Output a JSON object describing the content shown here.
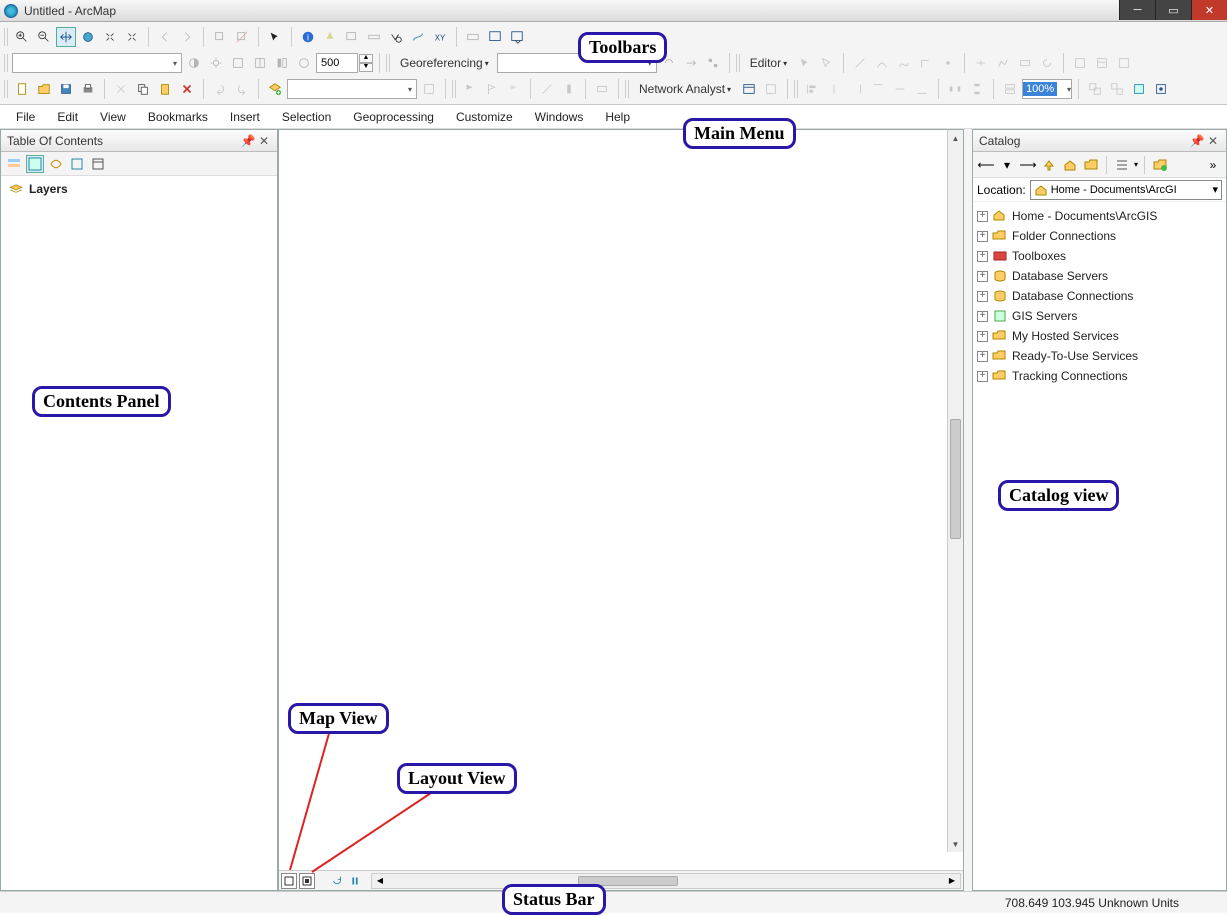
{
  "window": {
    "title": "Untitled - ArcMap"
  },
  "main_menu": [
    "File",
    "Edit",
    "View",
    "Bookmarks",
    "Insert",
    "Selection",
    "Geoprocessing",
    "Customize",
    "Windows",
    "Help"
  ],
  "georef_label": "Georeferencing",
  "editor_label": "Editor",
  "na_label": "Network Analyst",
  "scale_value": "500",
  "zoom_pct": "100%",
  "toc": {
    "title": "Table Of Contents",
    "root": "Layers"
  },
  "catalog": {
    "title": "Catalog",
    "location_label": "Location:",
    "location_value": "Home - Documents\\ArcGI",
    "tree": [
      "Home - Documents\\ArcGIS",
      "Folder Connections",
      "Toolboxes",
      "Database Servers",
      "Database Connections",
      "GIS Servers",
      "My Hosted Services",
      "Ready-To-Use Services",
      "Tracking Connections"
    ]
  },
  "status": {
    "coords": "708.649 103.945 Unknown Units"
  },
  "annotations": {
    "toolbars": "Toolbars",
    "main_menu": "Main Menu",
    "contents_panel": "Contents Panel",
    "map_view": "Map View",
    "layout_view": "Layout View",
    "catalog_view": "Catalog view",
    "status_bar": "Status Bar"
  }
}
